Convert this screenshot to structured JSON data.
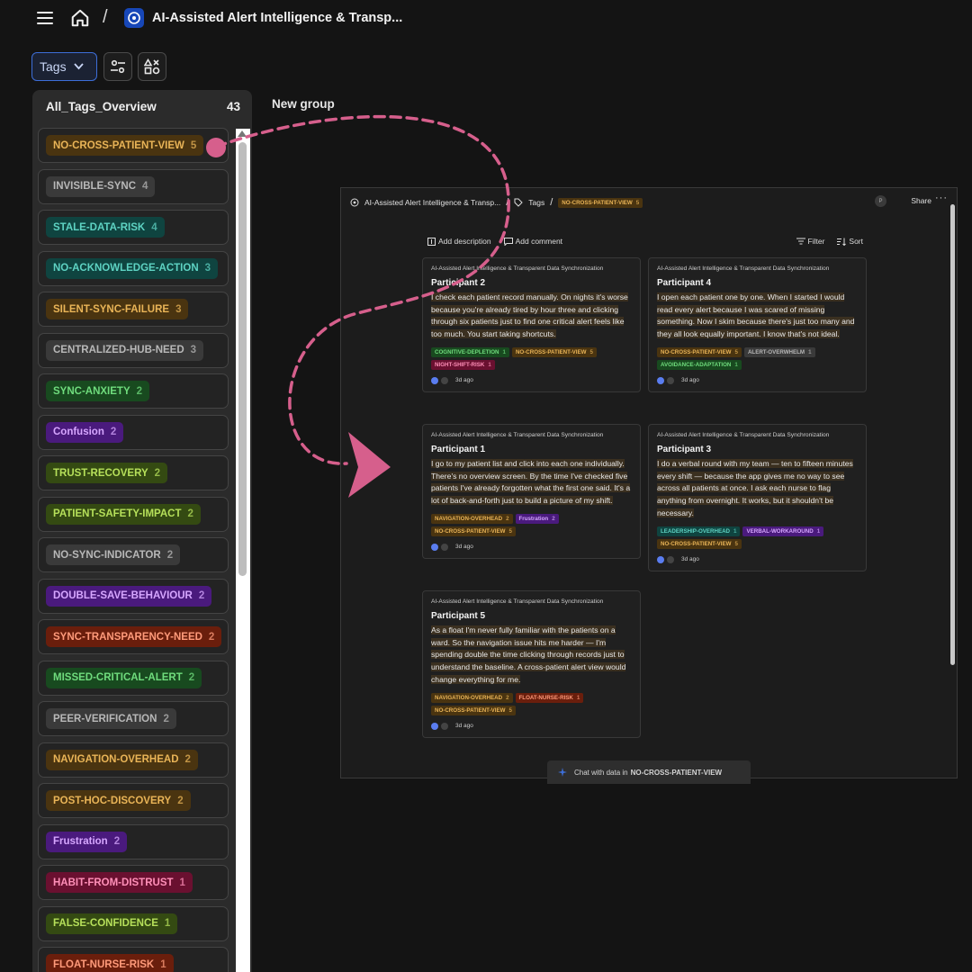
{
  "header": {
    "title": "AI-Assisted Alert Intelligence & Transp...",
    "breadcrumb_separator": "/"
  },
  "toolbar": {
    "tags_label": "Tags"
  },
  "sidebar": {
    "title": "All_Tags_Overview",
    "count": "43",
    "tags": [
      {
        "label": "NO-CROSS-PATIENT-VIEW",
        "count": "5",
        "bg": "#4a3410",
        "fg": "#e9b457"
      },
      {
        "label": "INVISIBLE-SYNC",
        "count": "4",
        "bg": "#3a3a3a",
        "fg": "#b8b8b8"
      },
      {
        "label": "STALE-DATA-RISK",
        "count": "4",
        "bg": "#0f4440",
        "fg": "#5ed3c3"
      },
      {
        "label": "NO-ACKNOWLEDGE-ACTION",
        "count": "3",
        "bg": "#0f4440",
        "fg": "#5ed3c3"
      },
      {
        "label": "SILENT-SYNC-FAILURE",
        "count": "3",
        "bg": "#4a3410",
        "fg": "#e9b457"
      },
      {
        "label": "CENTRALIZED-HUB-NEED",
        "count": "3",
        "bg": "#3a3a3a",
        "fg": "#b8b8b8"
      },
      {
        "label": "SYNC-ANXIETY",
        "count": "2",
        "bg": "#184a1f",
        "fg": "#6fdc7d"
      },
      {
        "label": "Confusion",
        "count": "2",
        "bg": "#4a1a7d",
        "fg": "#d6a6ff"
      },
      {
        "label": "TRUST-RECOVERY",
        "count": "2",
        "bg": "#344a12",
        "fg": "#b6e05a"
      },
      {
        "label": "PATIENT-SAFETY-IMPACT",
        "count": "2",
        "bg": "#344a12",
        "fg": "#b6e05a"
      },
      {
        "label": "NO-SYNC-INDICATOR",
        "count": "2",
        "bg": "#3a3a3a",
        "fg": "#b8b8b8"
      },
      {
        "label": "DOUBLE-SAVE-BEHAVIOUR",
        "count": "2",
        "bg": "#4a1a7d",
        "fg": "#d6a6ff"
      },
      {
        "label": "SYNC-TRANSPARENCY-NEED",
        "count": "2",
        "bg": "#6a1e0c",
        "fg": "#ff9a7a"
      },
      {
        "label": "MISSED-CRITICAL-ALERT",
        "count": "2",
        "bg": "#184a1f",
        "fg": "#6fdc7d"
      },
      {
        "label": "PEER-VERIFICATION",
        "count": "2",
        "bg": "#3a3a3a",
        "fg": "#b8b8b8"
      },
      {
        "label": "NAVIGATION-OVERHEAD",
        "count": "2",
        "bg": "#4a3410",
        "fg": "#e9b457"
      },
      {
        "label": "POST-HOC-DISCOVERY",
        "count": "2",
        "bg": "#4a3410",
        "fg": "#e9b457"
      },
      {
        "label": "Frustration",
        "count": "2",
        "bg": "#4a1a7d",
        "fg": "#d6a6ff"
      },
      {
        "label": "HABIT-FROM-DISTRUST",
        "count": "1",
        "bg": "#6a1030",
        "fg": "#ff8fb8"
      },
      {
        "label": "FALSE-CONFIDENCE",
        "count": "1",
        "bg": "#344a12",
        "fg": "#b6e05a"
      },
      {
        "label": "FLOAT-NURSE-RISK",
        "count": "1",
        "bg": "#6a1e0c",
        "fg": "#ff9a7a"
      }
    ]
  },
  "canvas": {
    "group_title": "New group"
  },
  "preview": {
    "breadcrumb_project": "AI-Assisted Alert Intelligence & Transp...",
    "breadcrumb_tags": "Tags",
    "current_tag": {
      "label": "NO-CROSS-PATIENT-VIEW",
      "count": "5"
    },
    "avatar_initial": "P",
    "share_label": "Share",
    "more_label": "···",
    "add_description": "Add description",
    "add_comment": "Add comment",
    "filter_label": "Filter",
    "sort_label": "Sort",
    "chat_prefix": "Chat with data in",
    "chat_tag": "NO-CROSS-PATIENT-VIEW",
    "cards": [
      {
        "project": "AI-Assisted Alert Intelligence & Transparent Data Synchronization",
        "participant": "Participant 2",
        "quote": "I check each patient record manually. On nights it's worse because you're already tired by hour three and clicking through six patients just to find one critical alert feels like too much. You start taking shortcuts.",
        "tags": [
          {
            "label": "COGNITIVE-DEPLETION",
            "count": "1",
            "bg": "#184a1f",
            "fg": "#6fdc7d"
          },
          {
            "label": "NO-CROSS-PATIENT-VIEW",
            "count": "5",
            "bg": "#4a3410",
            "fg": "#e9b457"
          },
          {
            "label": "NIGHT-SHIFT-RISK",
            "count": "1",
            "bg": "#6a1030",
            "fg": "#ff8fb8"
          }
        ],
        "time": "3d ago"
      },
      {
        "project": "AI-Assisted Alert Intelligence & Transparent Data Synchronization",
        "participant": "Participant 4",
        "quote": "I open each patient one by one. When I started I would read every alert because I was scared of missing something. Now I skim because there's just too many and they all look equally important. I know that's not ideal.",
        "tags": [
          {
            "label": "NO-CROSS-PATIENT-VIEW",
            "count": "5",
            "bg": "#4a3410",
            "fg": "#e9b457"
          },
          {
            "label": "ALERT-OVERWHELM",
            "count": "1",
            "bg": "#3a3a3a",
            "fg": "#b8b8b8"
          },
          {
            "label": "AVOIDANCE-ADAPTATION",
            "count": "1",
            "bg": "#184a1f",
            "fg": "#6fdc7d"
          }
        ],
        "time": "3d ago"
      },
      {
        "project": "AI-Assisted Alert Intelligence & Transparent Data Synchronization",
        "participant": "Participant 1",
        "quote": "I go to my patient list and click into each one individually. There's no overview screen. By the time I've checked five patients I've already forgotten what the first one said. It's a lot of back-and-forth just to build a picture of my shift.",
        "tags": [
          {
            "label": "NAVIGATION-OVERHEAD",
            "count": "2",
            "bg": "#4a3410",
            "fg": "#e9b457"
          },
          {
            "label": "Frustration",
            "count": "2",
            "bg": "#4a1a7d",
            "fg": "#d6a6ff"
          },
          {
            "label": "NO-CROSS-PATIENT-VIEW",
            "count": "5",
            "bg": "#4a3410",
            "fg": "#e9b457"
          }
        ],
        "time": "3d ago"
      },
      {
        "project": "AI-Assisted Alert Intelligence & Transparent Data Synchronization",
        "participant": "Participant 3",
        "quote": "I do a verbal round with my team — ten to fifteen minutes every shift — because the app gives me no way to see across all patients at once. I ask each nurse to flag anything from overnight. It works, but it shouldn't be necessary.",
        "tags": [
          {
            "label": "LEADERSHIP-OVERHEAD",
            "count": "1",
            "bg": "#0f4440",
            "fg": "#5ed3c3"
          },
          {
            "label": "VERBAL-WORKAROUND",
            "count": "1",
            "bg": "#4a1a7d",
            "fg": "#d6a6ff"
          },
          {
            "label": "NO-CROSS-PATIENT-VIEW",
            "count": "5",
            "bg": "#4a3410",
            "fg": "#e9b457"
          }
        ],
        "time": "3d ago"
      },
      {
        "project": "AI-Assisted Alert Intelligence & Transparent Data Synchronization",
        "participant": "Participant 5",
        "quote": "As a float I'm never fully familiar with the patients on a ward. So the navigation issue hits me harder — I'm spending double the time clicking through records just to understand the baseline. A cross-patient alert view would change everything for me.",
        "tags": [
          {
            "label": "NAVIGATION-OVERHEAD",
            "count": "2",
            "bg": "#4a3410",
            "fg": "#e9b457"
          },
          {
            "label": "FLOAT-NURSE-RISK",
            "count": "1",
            "bg": "#6a1e0c",
            "fg": "#ff9a7a"
          },
          {
            "label": "NO-CROSS-PATIENT-VIEW",
            "count": "5",
            "bg": "#4a3410",
            "fg": "#e9b457"
          }
        ],
        "time": "3d ago"
      }
    ]
  },
  "colors": {
    "accent": "#3d6ed8",
    "arrow": "#d65f8c"
  }
}
